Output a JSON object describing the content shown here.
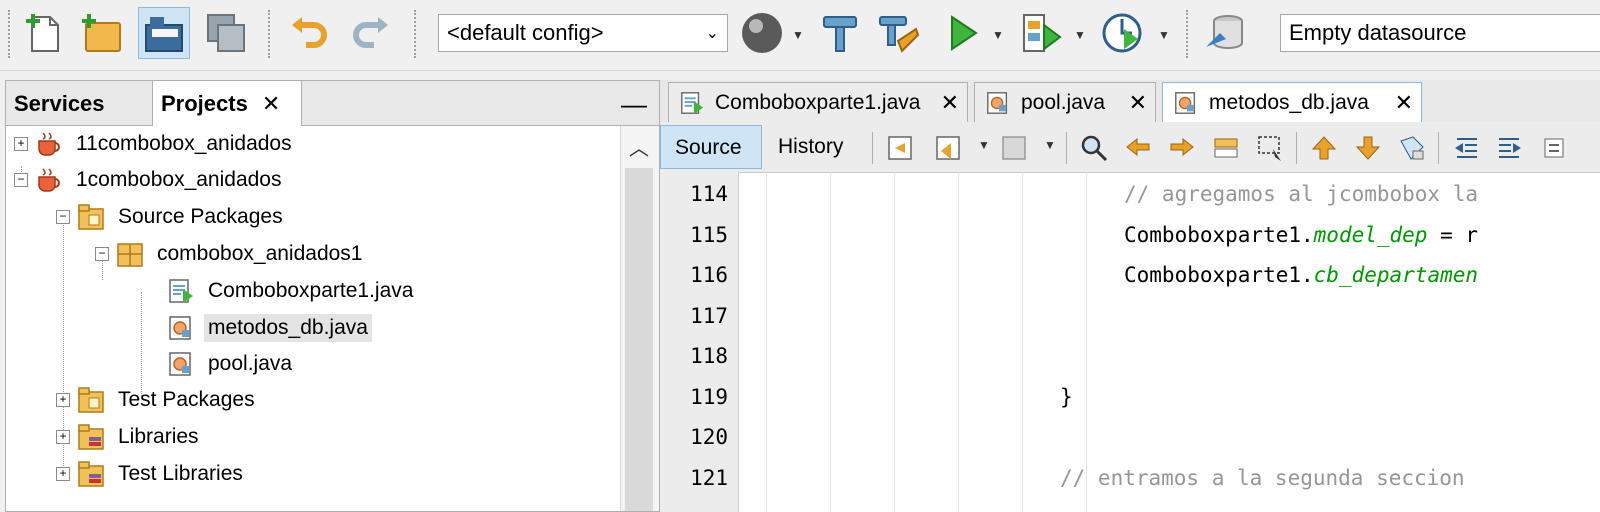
{
  "toolbar": {
    "config_value": "<default config>",
    "datasource_value": "Empty datasource",
    "icons": [
      "new-file-icon",
      "new-project-icon",
      "open-project-icon",
      "save-all-icon",
      "undo-icon",
      "redo-icon",
      "globe-icon",
      "build-icon",
      "clean-build-icon",
      "run-icon",
      "debug-icon",
      "profile-icon",
      "datasource-icon"
    ]
  },
  "left_panel": {
    "tabs": [
      {
        "label": "Services"
      },
      {
        "label": "Projects"
      }
    ],
    "close_glyph": "✕",
    "minimize_glyph": "—",
    "tree": [
      {
        "label": "11combobox_anidados",
        "expander": "+"
      },
      {
        "label": "1combobox_anidados",
        "expander": "−"
      },
      {
        "label": "Source Packages",
        "expander": "−"
      },
      {
        "label": "combobox_anidados1",
        "expander": "−"
      },
      {
        "label": "Comboboxparte1.java"
      },
      {
        "label": "metodos_db.java"
      },
      {
        "label": "pool.java"
      },
      {
        "label": "Test Packages",
        "expander": "+"
      },
      {
        "label": "Libraries",
        "expander": "+"
      },
      {
        "label": "Test Libraries",
        "expander": "+"
      }
    ]
  },
  "editor": {
    "tabs": [
      {
        "label": "Comboboxparte1.java"
      },
      {
        "label": "pool.java"
      },
      {
        "label": "metodos_db.java"
      }
    ],
    "close_glyph": "✕",
    "source_label": "Source",
    "history_label": "History",
    "line_numbers": [
      "114",
      "115",
      "116",
      "117",
      "118",
      "119",
      "120",
      "121"
    ],
    "lines": {
      "l114": "// agregamos al jcombobox la",
      "l115_class": "Comboboxparte1.",
      "l115_field": "model_dep",
      "l115_rest": " = r",
      "l116_class": "Comboboxparte1.",
      "l116_field": "cb_departamen",
      "l119": "}",
      "l121": "// entramos a la segunda seccion"
    }
  },
  "colors": {
    "comment": "#969696",
    "field": "#009900",
    "selection": "#cfe4f4"
  }
}
